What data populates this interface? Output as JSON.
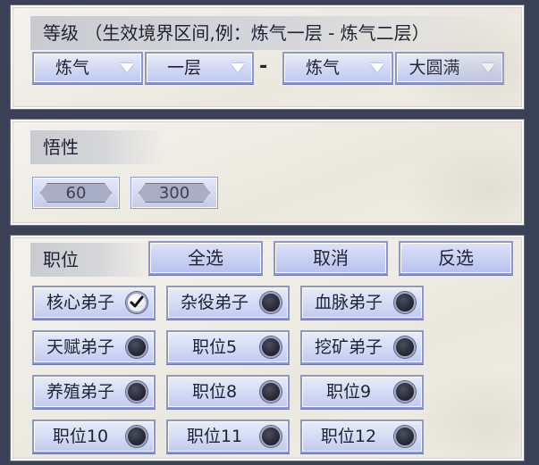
{
  "rank": {
    "title": "等级 （生效境界区间,例：炼气一层 - 炼气二层）",
    "from_realm": "炼气",
    "from_level": "一层",
    "separator": "-",
    "to_realm": "炼气",
    "to_level": "大圆满"
  },
  "comprehension": {
    "title": "悟性",
    "min": "60",
    "max": "300"
  },
  "position": {
    "title": "职位",
    "select_all": "全选",
    "cancel": "取消",
    "invert": "反选",
    "items": [
      {
        "label": "核心弟子",
        "checked": true
      },
      {
        "label": "杂役弟子",
        "checked": false
      },
      {
        "label": "血脉弟子",
        "checked": false
      },
      {
        "label": "天赋弟子",
        "checked": false
      },
      {
        "label": "职位5",
        "checked": false
      },
      {
        "label": "挖矿弟子",
        "checked": false
      },
      {
        "label": "养殖弟子",
        "checked": false
      },
      {
        "label": "职位8",
        "checked": false
      },
      {
        "label": "职位9",
        "checked": false
      },
      {
        "label": "职位10",
        "checked": false
      },
      {
        "label": "职位11",
        "checked": false
      },
      {
        "label": "职位12",
        "checked": false
      }
    ]
  }
}
